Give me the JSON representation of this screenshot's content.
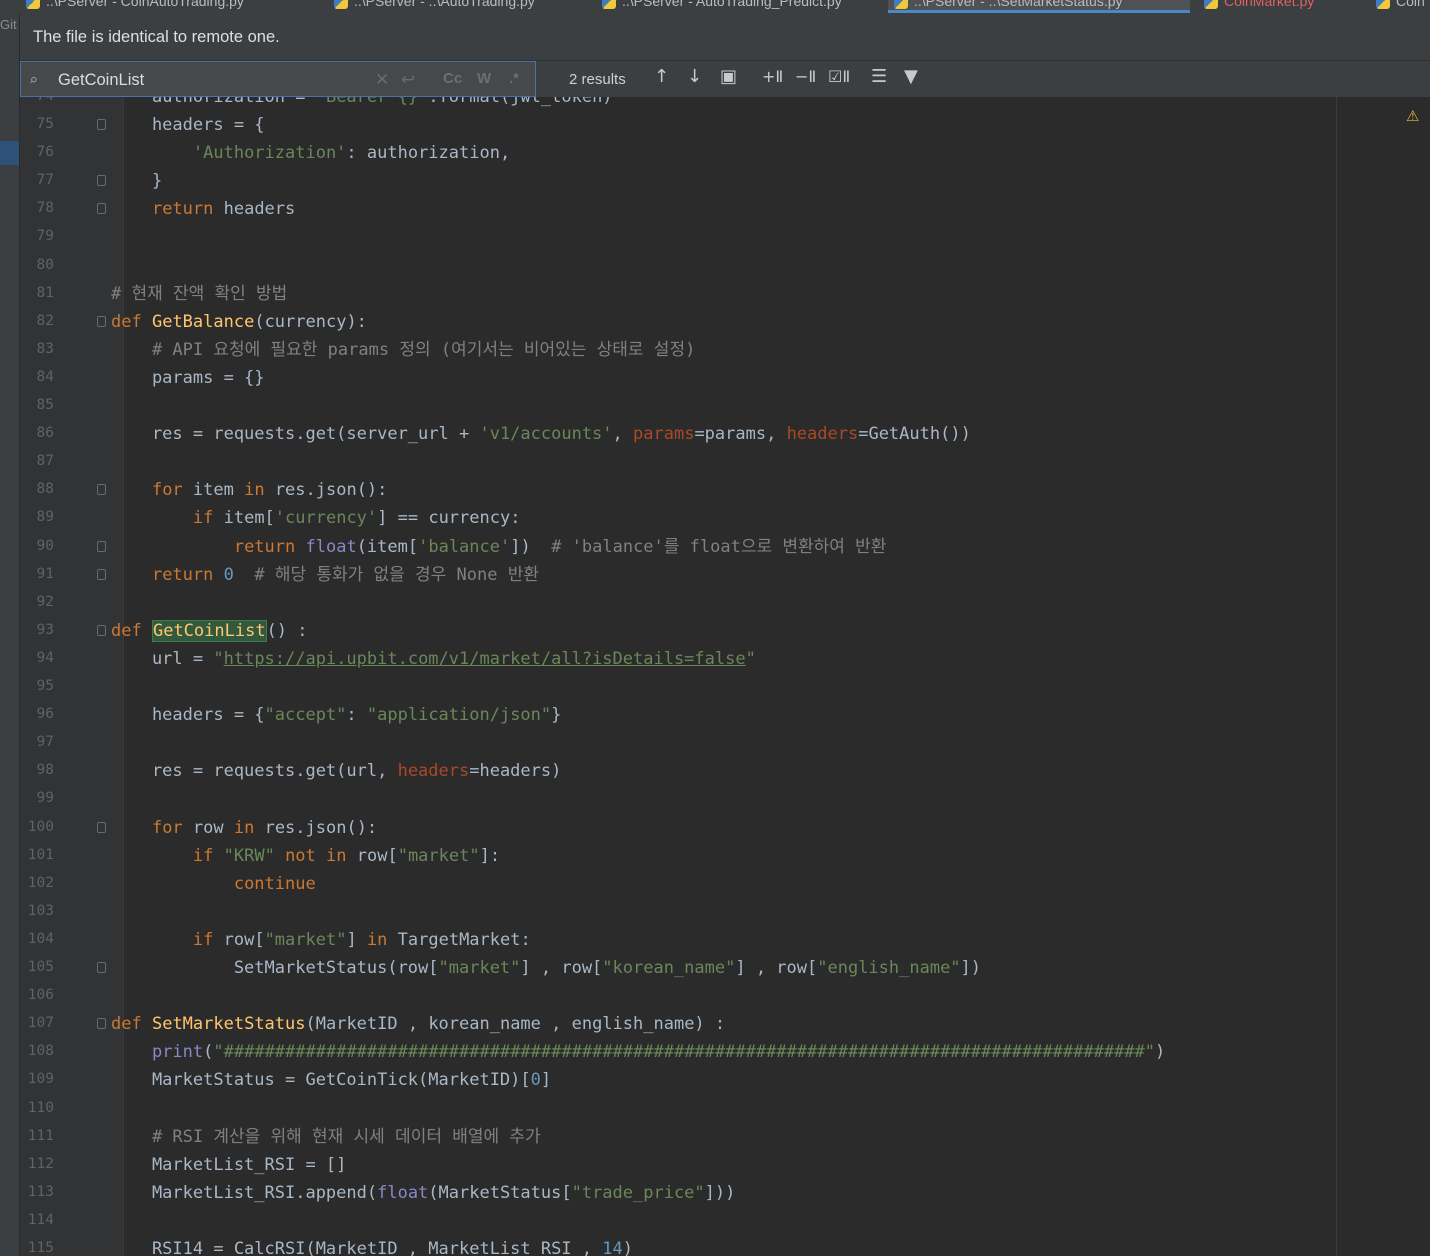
{
  "tabs": [
    {
      "label": "..\\PServer - CoinAutoTrading.py",
      "state": "normal"
    },
    {
      "label": "..\\PServer - ..\\AutoTrading.py",
      "state": "normal"
    },
    {
      "label": "..\\PServer - AutoTrading_Predict.py",
      "state": "normal"
    },
    {
      "label": "..\\PServer - ..\\SetMarketStatus.py",
      "state": "active"
    },
    {
      "label": "CoinMarket.py",
      "state": "error"
    },
    {
      "label": "Coin",
      "state": "normal"
    }
  ],
  "left_strip": {
    "label": "Git"
  },
  "banner": {
    "text": "The file is identical to remote one."
  },
  "search": {
    "query": "GetCoinList",
    "results": "2 results",
    "options": [
      "Cc",
      "W",
      ".*"
    ]
  },
  "toolbar_icons": [
    "clear-icon",
    "history-icon",
    "match-case-icon",
    "words-icon",
    "regex-icon",
    "prev-occurrence-icon",
    "next-occurrence-icon",
    "open-in-window-icon",
    "add-selection-icon",
    "remove-selection-icon",
    "select-all-icon",
    "filter-lines-icon",
    "filter-icon"
  ],
  "warning_badge": "⚠",
  "editor": {
    "first_line_partial": "    authorization = 'Bearer {}'.format(jwt_token)",
    "lines": [
      {
        "n": "74",
        "text": ""
      },
      {
        "n": "75",
        "text": "    headers = {"
      },
      {
        "n": "76",
        "text": "        'Authorization': authorization,"
      },
      {
        "n": "77",
        "text": "    }"
      },
      {
        "n": "78",
        "text": "    return headers"
      },
      {
        "n": "79",
        "text": ""
      },
      {
        "n": "80",
        "text": ""
      },
      {
        "n": "81",
        "text": "# 현재 잔액 확인 방법"
      },
      {
        "n": "82",
        "text": "def GetBalance(currency):"
      },
      {
        "n": "83",
        "text": "    # API 요청에 필요한 params 정의 (여기서는 비어있는 상태로 설정)"
      },
      {
        "n": "84",
        "text": "    params = {}"
      },
      {
        "n": "85",
        "text": ""
      },
      {
        "n": "86",
        "text": "    res = requests.get(server_url + 'v1/accounts', params=params, headers=GetAuth())"
      },
      {
        "n": "87",
        "text": ""
      },
      {
        "n": "88",
        "text": "    for item in res.json():"
      },
      {
        "n": "89",
        "text": "        if item['currency'] == currency:"
      },
      {
        "n": "90",
        "text": "            return float(item['balance'])  # 'balance'를 float으로 변환하여 반환"
      },
      {
        "n": "91",
        "text": "    return 0  # 해당 통화가 없을 경우 None 반환"
      },
      {
        "n": "92",
        "text": ""
      },
      {
        "n": "93",
        "text": "def GetCoinList() :"
      },
      {
        "n": "94",
        "text": "    url = \"https://api.upbit.com/v1/market/all?isDetails=false\""
      },
      {
        "n": "95",
        "text": ""
      },
      {
        "n": "96",
        "text": "    headers = {\"accept\": \"application/json\"}"
      },
      {
        "n": "97",
        "text": ""
      },
      {
        "n": "98",
        "text": "    res = requests.get(url, headers=headers)"
      },
      {
        "n": "99",
        "text": ""
      },
      {
        "n": "100",
        "text": "    for row in res.json():"
      },
      {
        "n": "101",
        "text": "        if \"KRW\" not in row[\"market\"]:"
      },
      {
        "n": "102",
        "text": "            continue"
      },
      {
        "n": "103",
        "text": ""
      },
      {
        "n": "104",
        "text": "        if row[\"market\"] in TargetMarket:"
      },
      {
        "n": "105",
        "text": "            SetMarketStatus(row[\"market\"] , row[\"korean_name\"] , row[\"english_name\"])"
      },
      {
        "n": "106",
        "text": ""
      },
      {
        "n": "107",
        "text": "def SetMarketStatus(MarketID , korean_name , english_name) :"
      },
      {
        "n": "108",
        "text": "    print(\"##########################################################################################\")"
      },
      {
        "n": "109",
        "text": "    MarketStatus = GetCoinTick(MarketID)[0]"
      },
      {
        "n": "110",
        "text": ""
      },
      {
        "n": "111",
        "text": "    # RSI 계산을 위해 현재 시세 데이터 배열에 추가"
      },
      {
        "n": "112",
        "text": "    MarketList_RSI = []"
      },
      {
        "n": "113",
        "text": "    MarketList_RSI.append(float(MarketStatus[\"trade_price\"]))"
      },
      {
        "n": "114",
        "text": ""
      },
      {
        "n": "115",
        "text": "    RSI14 = CalcRSI(MarketID , MarketList_RSI , 14)"
      }
    ]
  },
  "colors": {
    "keyword": "#cc7832",
    "function": "#ffc66d",
    "string": "#6a8759",
    "comment": "#808080",
    "number": "#6897bb",
    "param": "#aa4926",
    "builtin": "#8888c6",
    "text": "#a9b7c6",
    "background": "#2b2b2b",
    "match_highlight": "#32593d"
  }
}
